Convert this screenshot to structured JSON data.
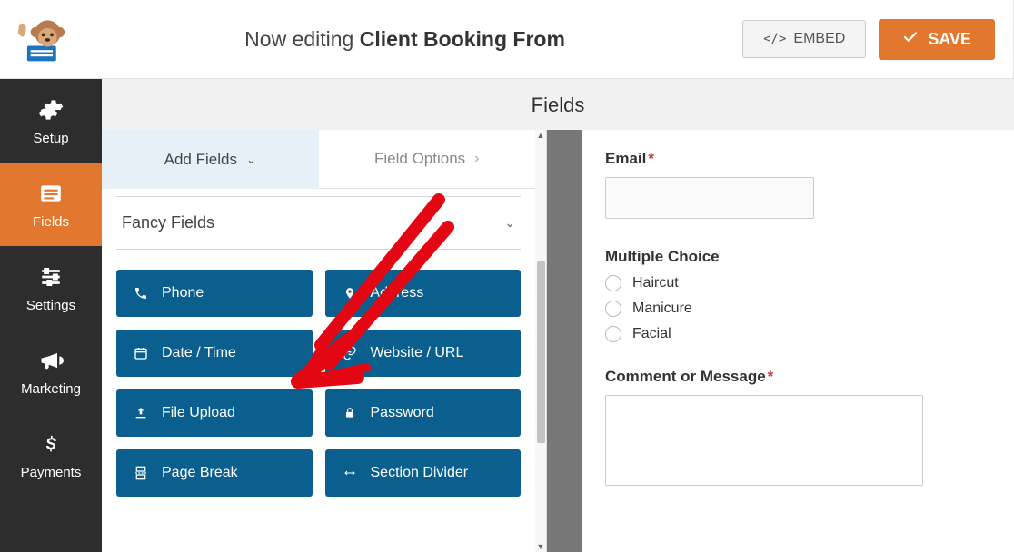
{
  "header": {
    "editing_prefix": "Now editing ",
    "form_name": "Client Booking From",
    "embed_label": "EMBED",
    "save_label": "SAVE"
  },
  "sidebar": {
    "items": [
      {
        "label": "Setup",
        "icon": "gear-icon"
      },
      {
        "label": "Fields",
        "icon": "list-icon"
      },
      {
        "label": "Settings",
        "icon": "sliders-icon"
      },
      {
        "label": "Marketing",
        "icon": "bullhorn-icon"
      },
      {
        "label": "Payments",
        "icon": "dollar-icon"
      }
    ],
    "active_index": 1
  },
  "panel": {
    "title": "Fields",
    "tabs": {
      "add_fields": "Add Fields",
      "field_options": "Field Options"
    },
    "section_title": "Fancy Fields",
    "field_buttons": [
      {
        "label": "Phone",
        "icon": "phone-icon"
      },
      {
        "label": "Address",
        "icon": "map-marker-icon"
      },
      {
        "label": "Date / Time",
        "icon": "calendar-icon"
      },
      {
        "label": "Website / URL",
        "icon": "link-icon"
      },
      {
        "label": "File Upload",
        "icon": "upload-icon"
      },
      {
        "label": "Password",
        "icon": "lock-icon"
      },
      {
        "label": "Page Break",
        "icon": "page-break-icon"
      },
      {
        "label": "Section Divider",
        "icon": "arrows-h-icon"
      }
    ]
  },
  "preview": {
    "email_label": "Email",
    "mc_label": "Multiple Choice",
    "options": [
      "Haircut",
      "Manicure",
      "Facial"
    ],
    "comment_label": "Comment or Message"
  }
}
